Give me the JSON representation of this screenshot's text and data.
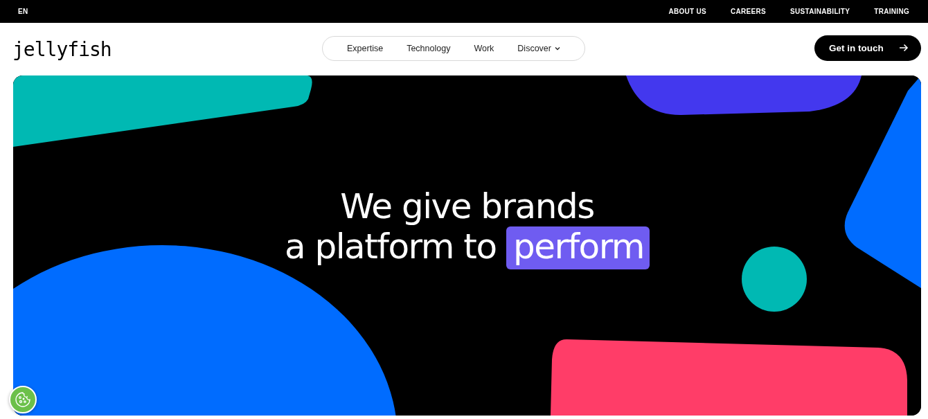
{
  "top_bar": {
    "language": "EN",
    "links": [
      "ABOUT US",
      "CAREERS",
      "SUSTAINABILITY",
      "TRAINING"
    ]
  },
  "header": {
    "logo": "jellyfish",
    "nav": [
      {
        "label": "Expertise",
        "dropdown": false
      },
      {
        "label": "Technology",
        "dropdown": false
      },
      {
        "label": "Work",
        "dropdown": false
      },
      {
        "label": "Discover",
        "dropdown": true
      }
    ],
    "cta": "Get in touch"
  },
  "hero": {
    "line_1": "We give brands",
    "line_2": "a platform to",
    "highlight": "perform"
  }
}
